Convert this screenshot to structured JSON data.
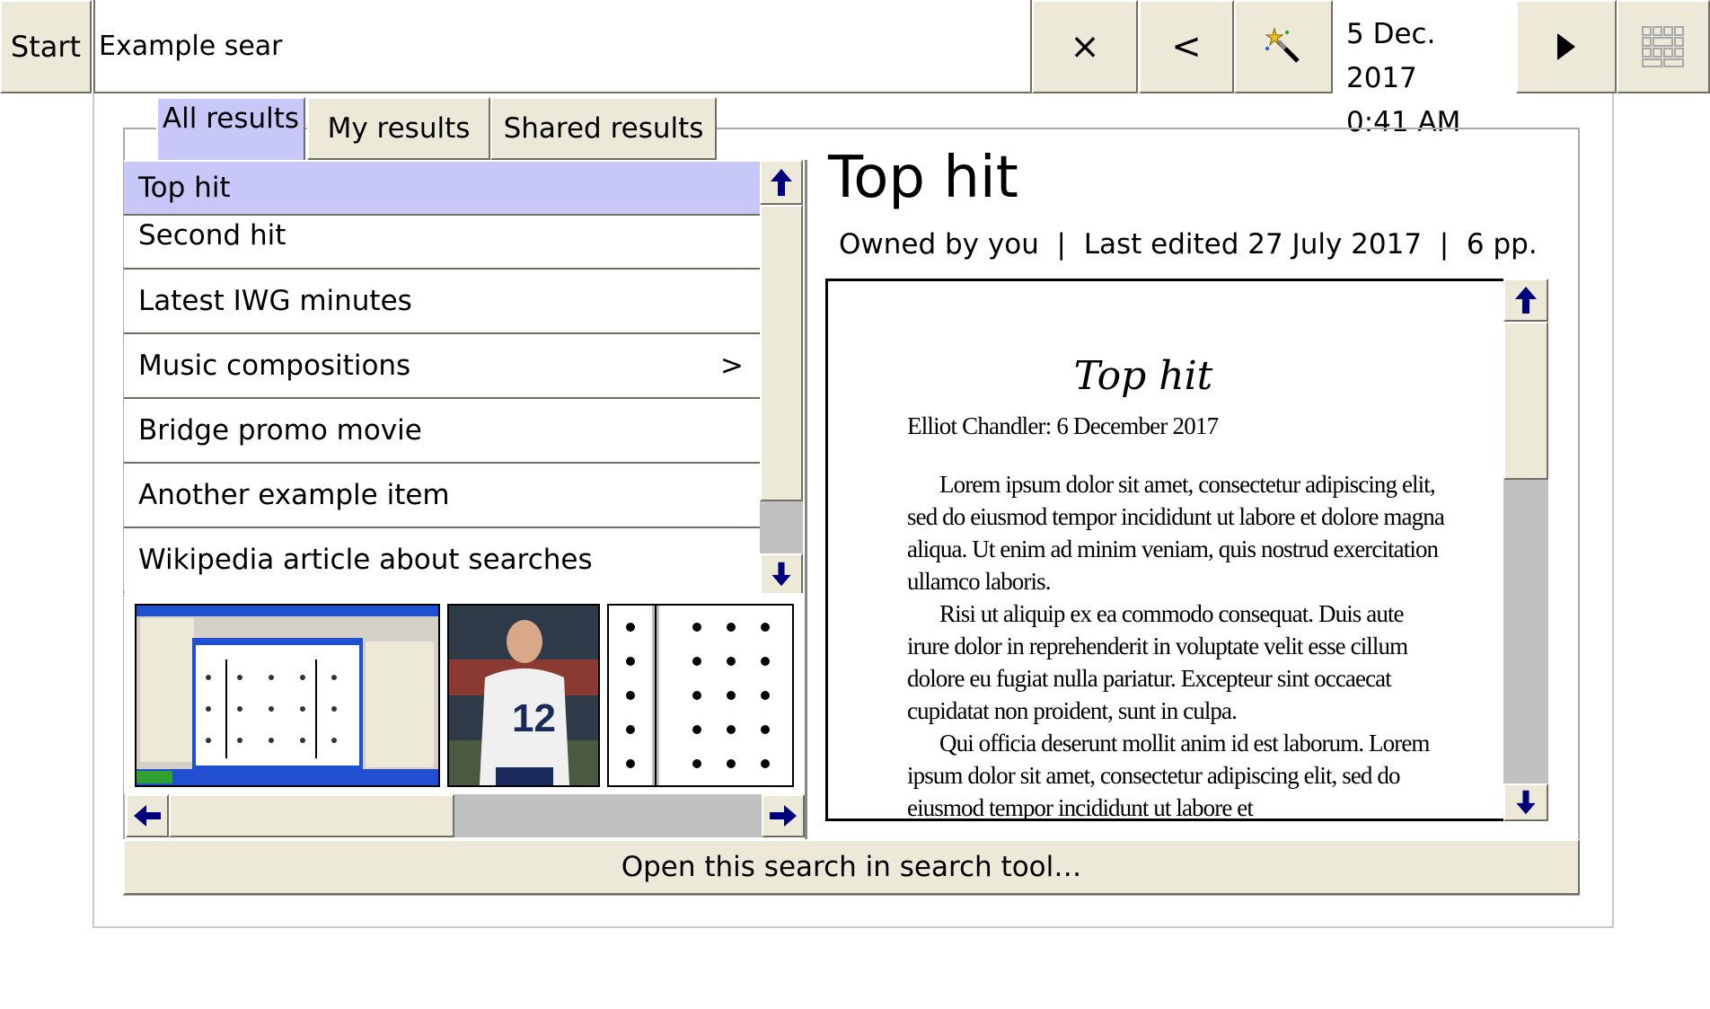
{
  "topbar": {
    "start_label": "Start",
    "search_value": "Example sear",
    "clear_icon": "×",
    "back_icon": "<",
    "date": "5 Dec. 2017",
    "time": "0:41 AM"
  },
  "tabs": [
    {
      "label": "All results",
      "active": true
    },
    {
      "label": "My results",
      "active": false
    },
    {
      "label": "Shared results",
      "active": false
    }
  ],
  "results": [
    {
      "label": "Top hit",
      "selected": true
    },
    {
      "label": "Second hit"
    },
    {
      "label": "Latest IWG minutes"
    },
    {
      "label": "Music compositions",
      "chevron": ">"
    },
    {
      "label": "Bridge promo movie"
    },
    {
      "label": "Another example item"
    },
    {
      "label": "Wikipedia article about searches"
    }
  ],
  "preview": {
    "title": "Top hit",
    "meta": "Owned by you  |  Last edited 27 July 2017  |  6 pp.",
    "doc_title": "Top hit",
    "doc_author": "Elliot Chandler: 6 December 2017",
    "doc_paragraphs": [
      "Lorem ipsum dolor sit amet, consectetur adipiscing elit, sed do eiusmod tempor incididunt ut labore et dolore magna aliqua. Ut enim ad minim veniam, quis nostrud exercitation ullamco laboris.",
      "Risi ut aliquip ex ea commodo consequat. Duis aute irure dolor in reprehenderit in voluptate velit esse cillum dolore eu fugiat nulla pariatur. Excepteur sint occaecat cupidatat non proident, sunt in culpa.",
      "Qui officia deserunt mollit anim id est laborum. Lorem ipsum dolor sit amet, consectetur adipiscing elit, sed do eiusmod tempor incididunt ut labore et"
    ]
  },
  "open_button_label": "Open this search in search tool…",
  "colors": {
    "selection": "#c8c8f8",
    "chrome": "#ece9d8",
    "arrow": "#00007f"
  }
}
